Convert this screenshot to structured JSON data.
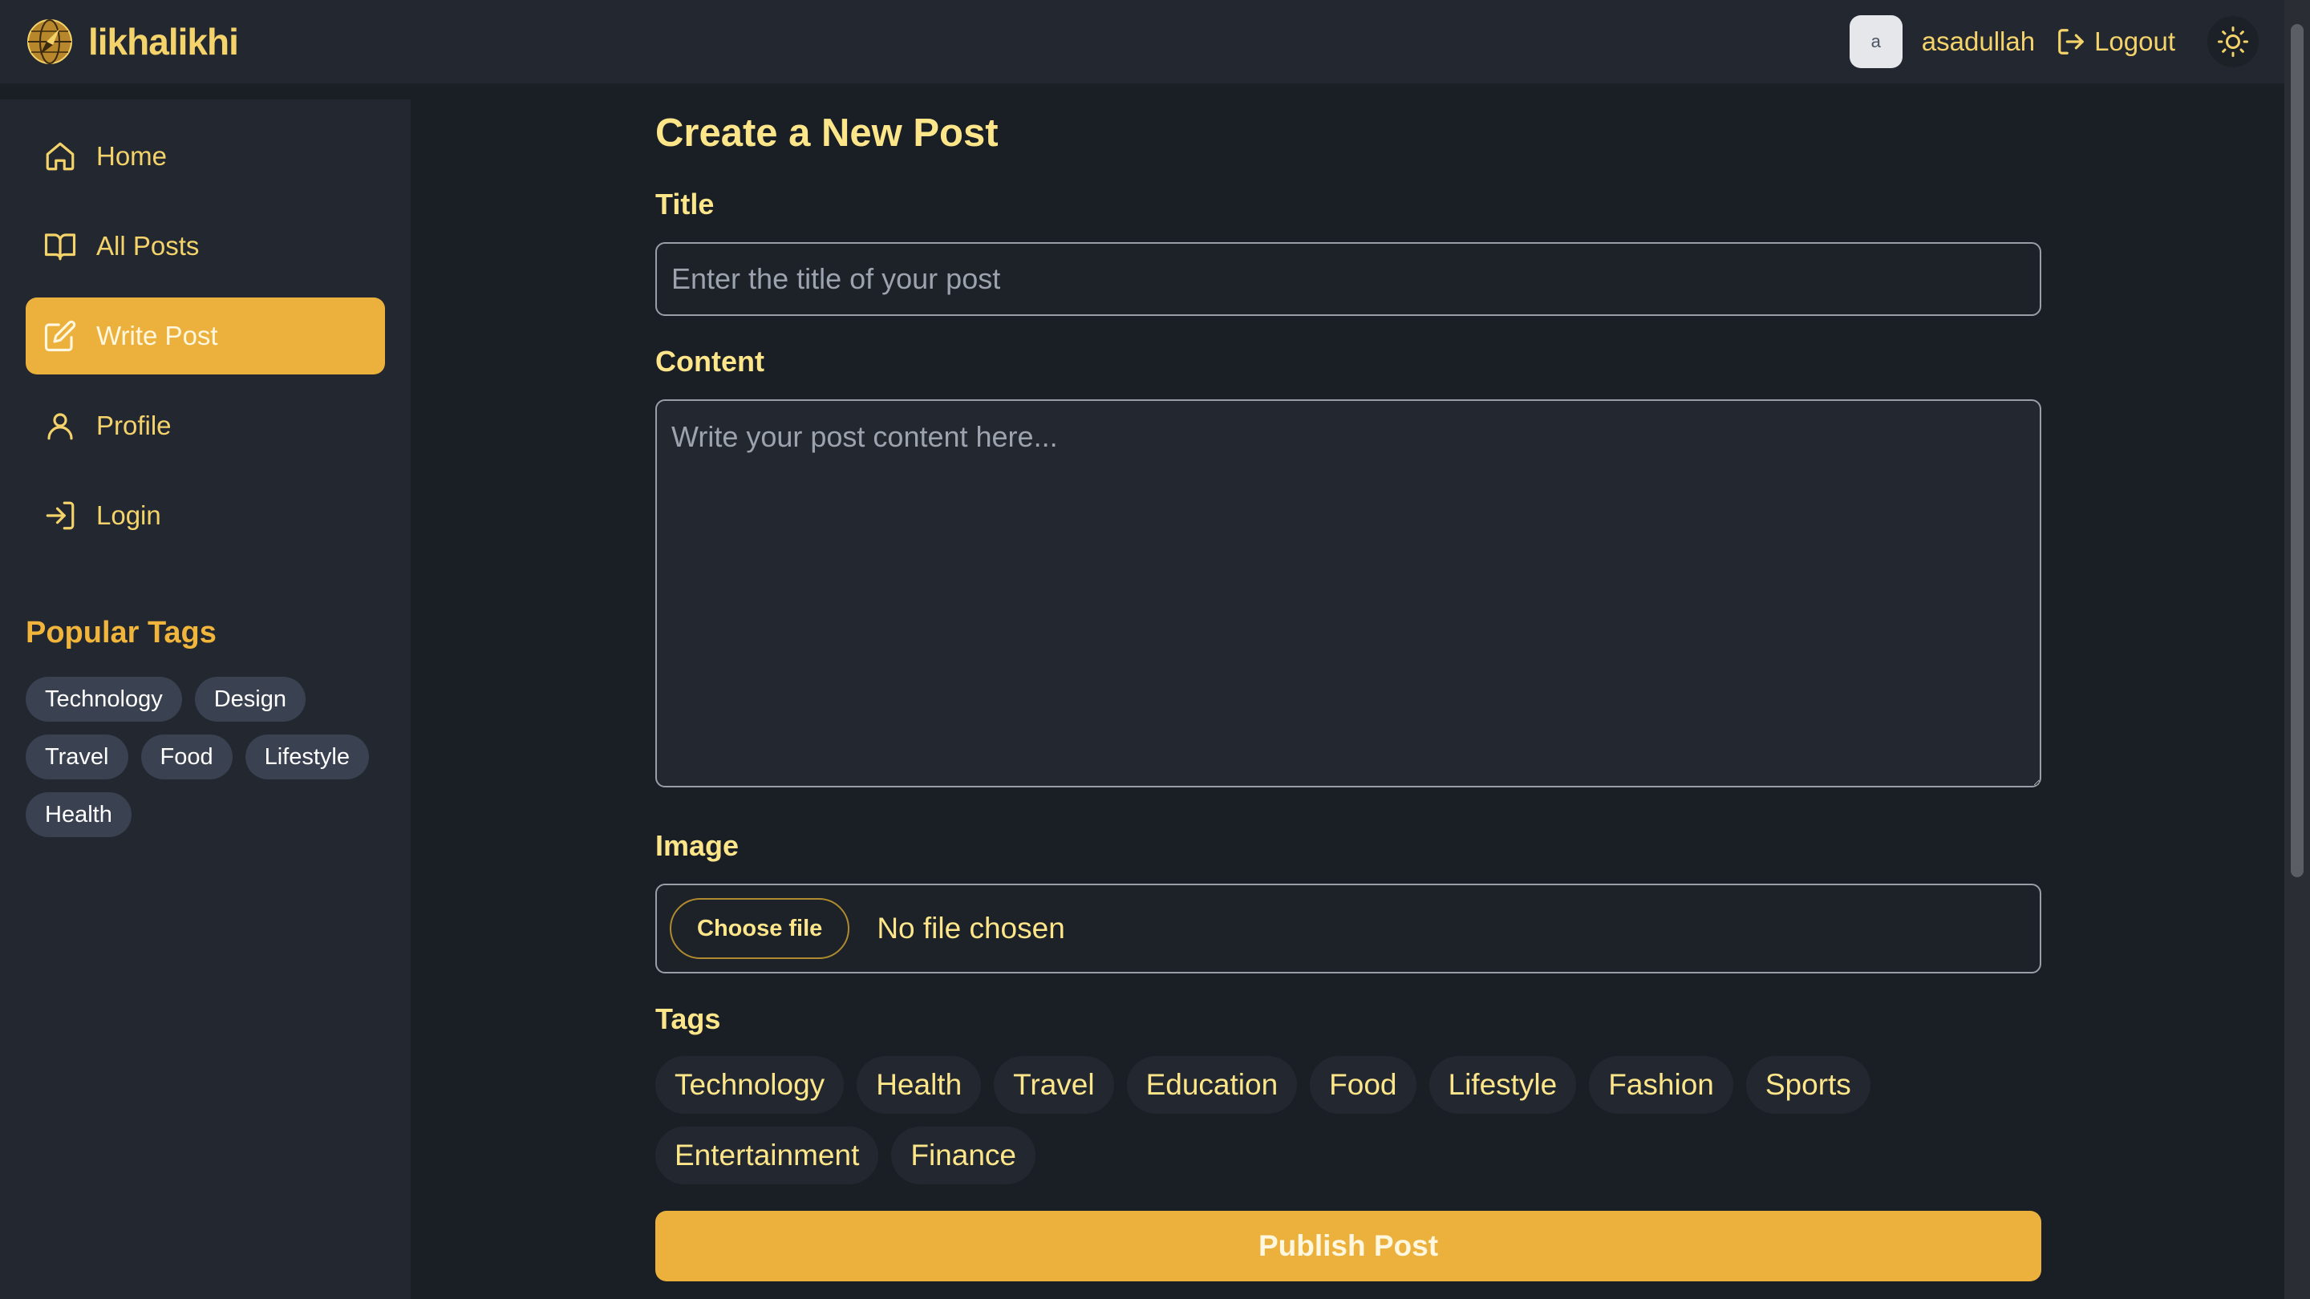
{
  "header": {
    "brand": "likhalikhi",
    "logo_icon": "compass-globe-icon",
    "avatar_initial": "a",
    "username": "asadullah",
    "logout_label": "Logout",
    "theme_icon": "sun-icon"
  },
  "colors": {
    "accent": "#ecb13c",
    "text_accent": "#f5d36b",
    "background": "#1a1e25",
    "panel": "#232830",
    "tag_bg": "#3a4150"
  },
  "sidebar": {
    "items": [
      {
        "label": "Home",
        "icon": "home-icon",
        "active": false
      },
      {
        "label": "All Posts",
        "icon": "book-open-icon",
        "active": false
      },
      {
        "label": "Write Post",
        "icon": "edit-icon",
        "active": true
      },
      {
        "label": "Profile",
        "icon": "user-icon",
        "active": false
      },
      {
        "label": "Login",
        "icon": "login-icon",
        "active": false
      }
    ],
    "popular_tags_title": "Popular Tags",
    "popular_tags": [
      "Technology",
      "Design",
      "Travel",
      "Food",
      "Lifestyle",
      "Health"
    ]
  },
  "form": {
    "page_title": "Create a New Post",
    "title_label": "Title",
    "title_placeholder": "Enter the title of your post",
    "title_value": "",
    "content_label": "Content",
    "content_placeholder": "Write your post content here...",
    "content_value": "",
    "image_label": "Image",
    "choose_file_label": "Choose file",
    "file_status": "No file chosen",
    "tags_label": "Tags",
    "tags": [
      "Technology",
      "Health",
      "Travel",
      "Education",
      "Food",
      "Lifestyle",
      "Fashion",
      "Sports",
      "Entertainment",
      "Finance"
    ],
    "publish_label": "Publish Post"
  }
}
